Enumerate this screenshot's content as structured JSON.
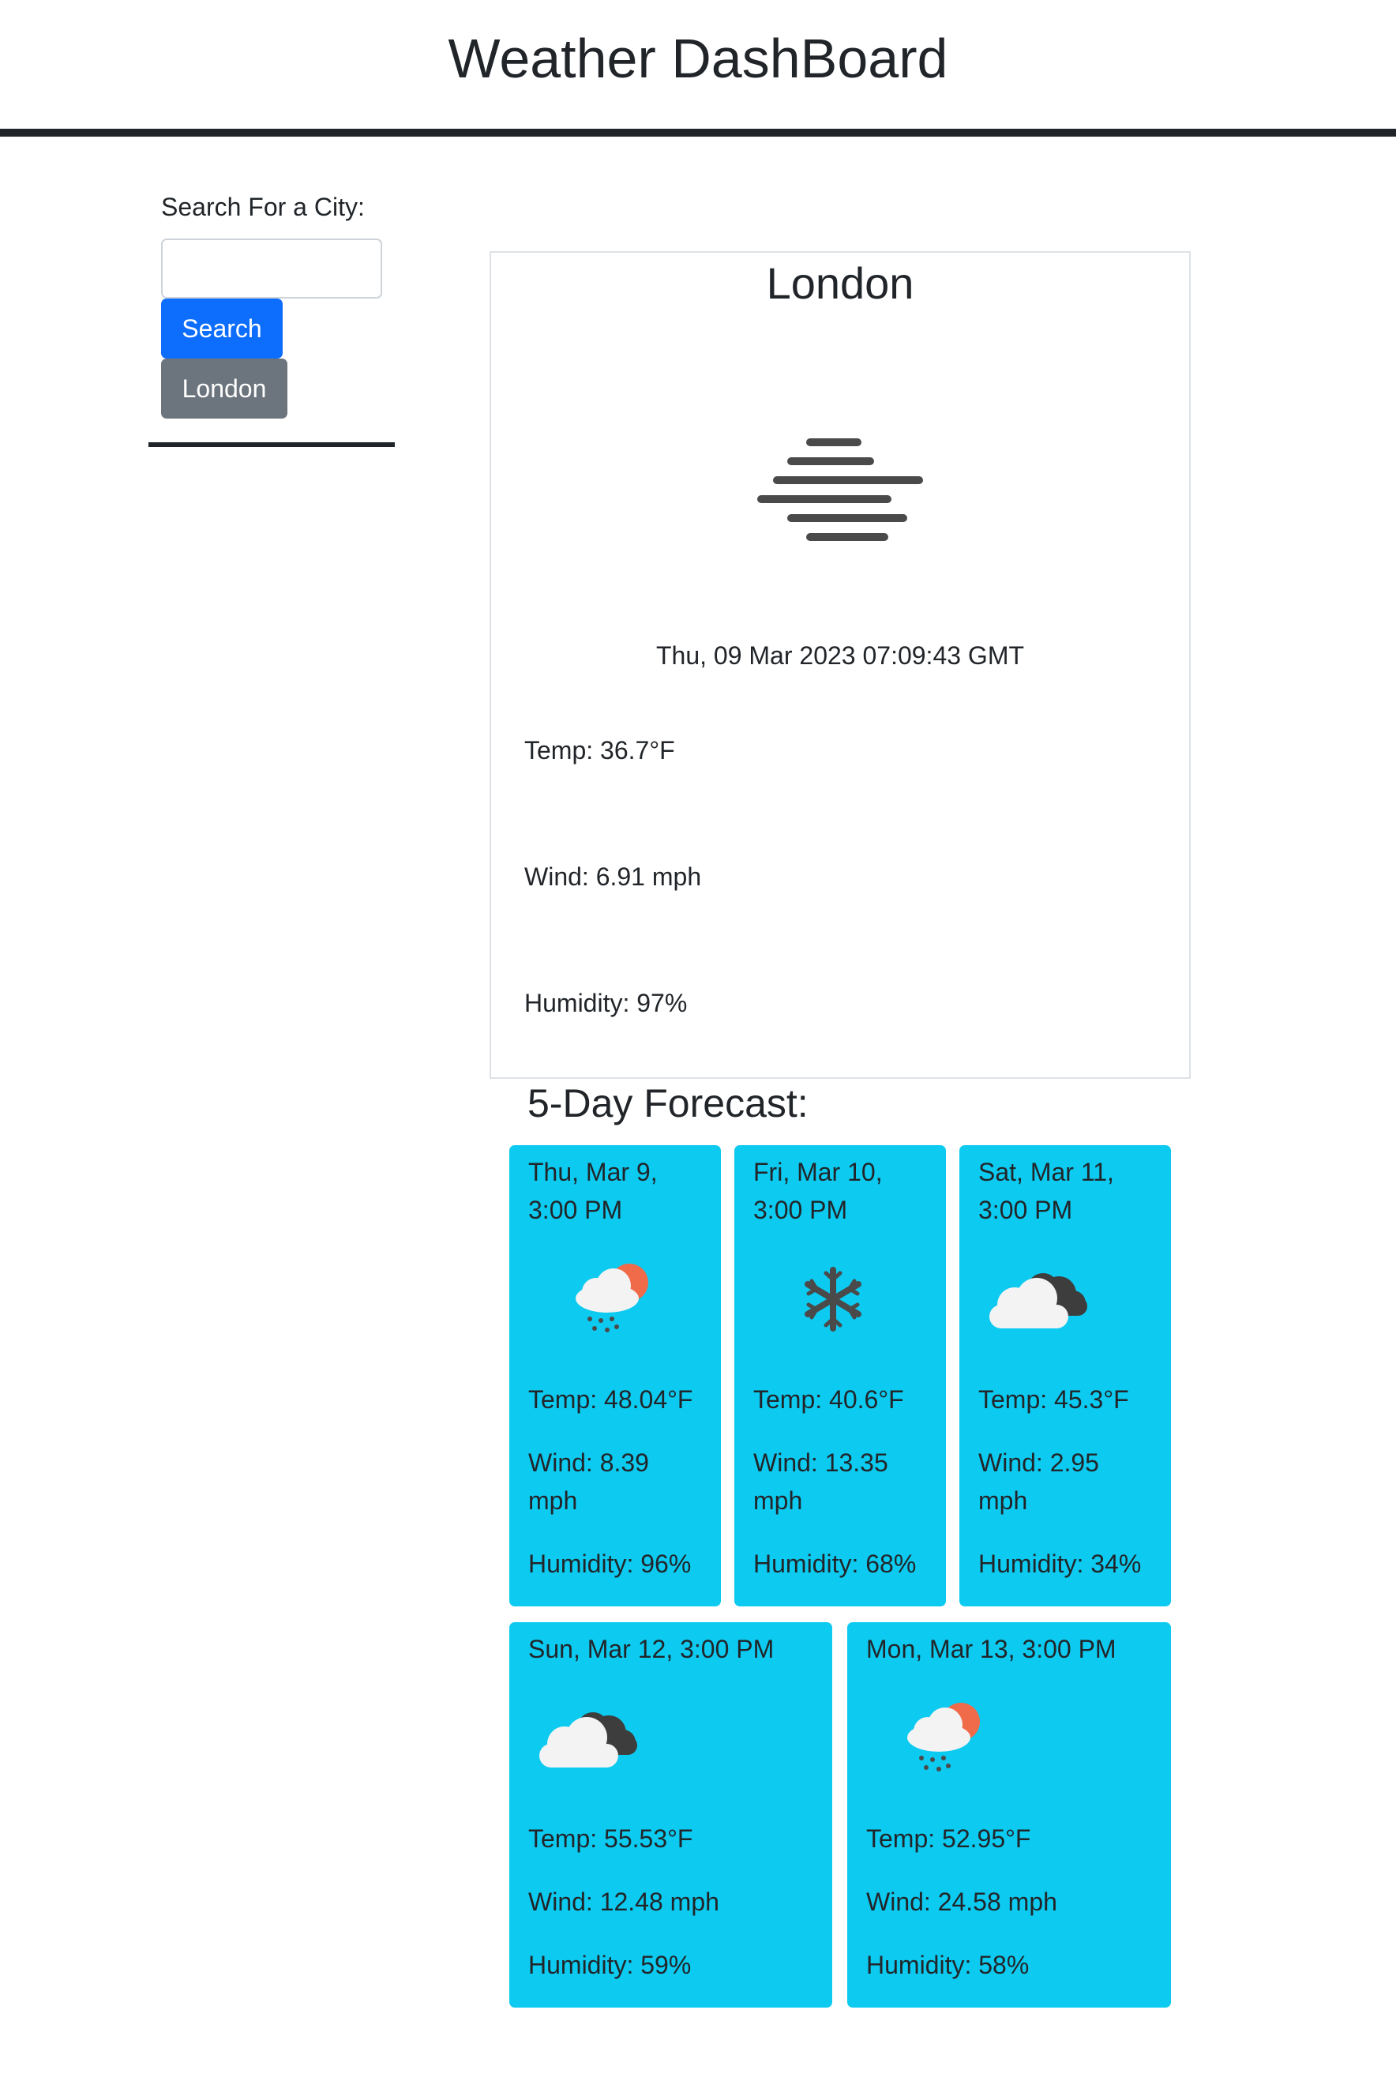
{
  "header": {
    "title": "Weather DashBoard"
  },
  "sidebar": {
    "search_label": "Search For a City:",
    "search_value": "",
    "search_button": "Search",
    "history": [
      "London"
    ]
  },
  "current": {
    "city": "London",
    "icon": "mist-icon",
    "datetime": "Thu, 09 Mar 2023 07:09:43 GMT",
    "temp": "Temp: 36.7°F",
    "wind": "Wind: 6.91 mph",
    "humidity": "Humidity: 97%"
  },
  "forecast": {
    "title": "5-Day Forecast:",
    "days": [
      {
        "date_line1": "Thu, Mar 9,",
        "date_line2": "3:00 PM",
        "icon": "sun-cloud-rain-icon",
        "temp": "Temp: 48.04°F",
        "wind_line1": "Wind: 8.39",
        "wind_line2": "mph",
        "humidity": "Humidity: 96%"
      },
      {
        "date_line1": "Fri, Mar 10,",
        "date_line2": "3:00 PM",
        "icon": "snowflake-icon",
        "temp": "Temp: 40.6°F",
        "wind_line1": "Wind: 13.35",
        "wind_line2": "mph",
        "humidity": "Humidity: 68%"
      },
      {
        "date_line1": "Sat, Mar 11,",
        "date_line2": "3:00 PM",
        "icon": "broken-clouds-icon",
        "temp": "Temp: 45.3°F",
        "wind_line1": "Wind: 2.95",
        "wind_line2": "mph",
        "humidity": "Humidity: 34%"
      },
      {
        "date_line1": "Sun, Mar 12, 3:00 PM",
        "icon": "broken-clouds-icon",
        "temp": "Temp: 55.53°F",
        "wind": "Wind: 12.48 mph",
        "humidity": "Humidity: 59%"
      },
      {
        "date_line1": "Mon, Mar 13, 3:00 PM",
        "icon": "sun-cloud-rain-icon",
        "temp": "Temp: 52.95°F",
        "wind": "Wind: 24.58 mph",
        "humidity": "Humidity: 58%"
      }
    ]
  },
  "colors": {
    "primary": "#0d6efd",
    "secondary": "#6c757d",
    "card": "#0dcaf0",
    "dark": "#212529",
    "sun": "#ef6b4a"
  }
}
